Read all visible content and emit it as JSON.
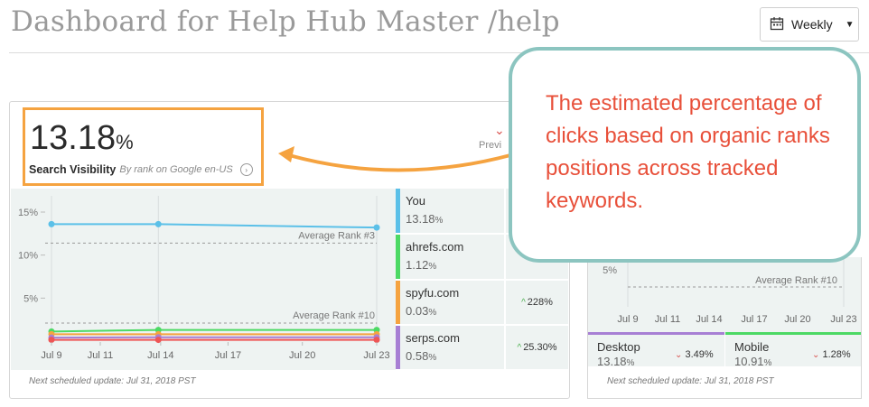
{
  "header": {
    "title": "Dashboard for Help Hub Master /help",
    "period_button": {
      "label": "Weekly",
      "icon": "calendar-icon"
    }
  },
  "kpi": {
    "value": "13.18",
    "unit": "%",
    "label": "Search Visibility",
    "sublabel": "By rank on Google en-US",
    "previous_fragment": "Previ"
  },
  "visibility_chart": {
    "chart_data": {
      "type": "line",
      "x": [
        "Jul 9",
        "Jul 11",
        "Jul 14",
        "Jul 17",
        "Jul 20",
        "Jul 23"
      ],
      "ylim": [
        0,
        15
      ],
      "yticks": [
        "15%",
        "10%",
        "5%"
      ],
      "series": [
        {
          "name": "You",
          "points": [
            [
              0,
              13.6
            ],
            [
              4.6,
              13.6
            ],
            [
              14,
              13.2
            ]
          ],
          "color": "#5bc0e8"
        },
        {
          "name": "ahrefs.com",
          "points": [
            [
              0,
              1.12
            ],
            [
              4.6,
              1.3
            ],
            [
              14,
              1.3
            ]
          ],
          "color": "#4cd964"
        },
        {
          "name": "spyfu.com",
          "points": [
            [
              0,
              0.8
            ],
            [
              4.6,
              0.8
            ],
            [
              14,
              0.8
            ]
          ],
          "color": "#f5a340"
        },
        {
          "name": "serps.com",
          "points": [
            [
              0,
              0.4
            ],
            [
              4.6,
              0.45
            ],
            [
              14,
              0.45
            ]
          ],
          "color": "#a77fd4"
        },
        {
          "name": "",
          "points": [
            [
              0,
              0.15
            ],
            [
              4.6,
              0.15
            ],
            [
              14,
              0.15
            ]
          ],
          "color": "#e55"
        }
      ],
      "reference_lines": [
        {
          "label": "Average Rank #3",
          "y": 11.4
        },
        {
          "label": "Average Rank #10",
          "y": 2.1
        }
      ]
    }
  },
  "legend": [
    {
      "name": "You",
      "value": "13.18",
      "unit": "%",
      "color": "#5bc0e8",
      "change": ""
    },
    {
      "name": "ahrefs.com",
      "value": "1.12",
      "unit": "%",
      "color": "#4cd964",
      "change": ""
    },
    {
      "name": "spyfu.com",
      "value": "0.03",
      "unit": "%",
      "color": "#f5a340",
      "change": "228%"
    },
    {
      "name": "serps.com",
      "value": "0.58",
      "unit": "%",
      "color": "#a77fd4",
      "change": "25.30%"
    }
  ],
  "footnote_left": "Next scheduled update: Jul 31, 2018 PST",
  "device_chart": {
    "chart_data": {
      "type": "line",
      "x": [
        "Jul 9",
        "Jul 11",
        "Jul 14",
        "Jul 17",
        "Jul 20",
        "Jul 23"
      ],
      "yticks": [
        "5%"
      ],
      "reference_lines": [
        {
          "label": "Average Rank #10"
        }
      ]
    }
  },
  "devices": [
    {
      "name": "Desktop",
      "value": "13.18",
      "unit": "%",
      "change": "3.49%",
      "color": "#a77fd4"
    },
    {
      "name": "Mobile",
      "value": "10.91",
      "unit": "%",
      "change": "1.28%",
      "color": "#4cd964"
    }
  ],
  "footnote_right": "Next scheduled update: Jul 31, 2018 PST",
  "callout": {
    "text": "The estimated percentage of clicks based on organic ranks positions across tracked keywords."
  }
}
